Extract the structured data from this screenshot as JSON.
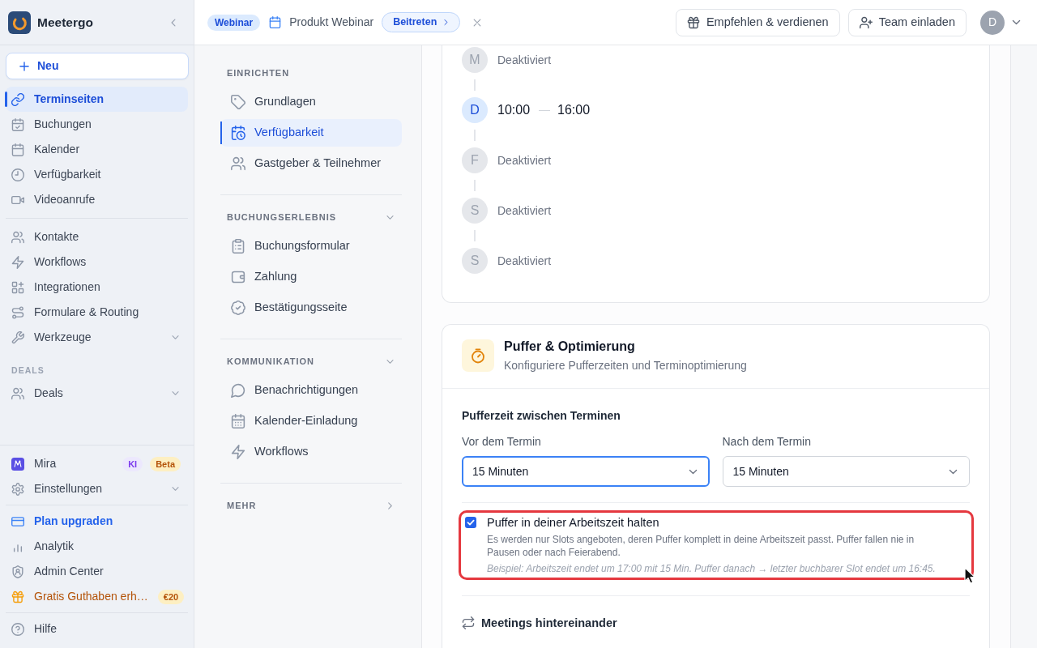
{
  "sidebar": {
    "brand": "Meetergo",
    "new_button": "Neu",
    "groups": [
      {
        "items": [
          {
            "label": "Terminseiten",
            "kind": "link",
            "selected": true
          },
          {
            "label": "Buchungen",
            "kind": "link",
            "selected": false
          },
          {
            "label": "Kalender",
            "kind": "link",
            "selected": false
          },
          {
            "label": "Verfügbarkeit",
            "kind": "link",
            "selected": false
          },
          {
            "label": "Videoanrufe",
            "kind": "link",
            "selected": false
          }
        ]
      },
      {
        "items": [
          {
            "label": "Kontakte",
            "kind": "link",
            "selected": false
          },
          {
            "label": "Workflows",
            "kind": "link",
            "selected": false
          },
          {
            "label": "Integrationen",
            "kind": "link",
            "selected": false
          },
          {
            "label": "Formulare & Routing",
            "kind": "link",
            "selected": false
          },
          {
            "label": "Werkzeuge",
            "kind": "menu",
            "selected": false
          }
        ]
      },
      {
        "title": "DEALS",
        "items": [
          {
            "label": "Deals",
            "kind": "menu",
            "selected": false
          }
        ]
      }
    ],
    "footer_groups": [
      {
        "items": [
          {
            "label": "Mira",
            "kind": "link",
            "selected": false,
            "badges": [
              {
                "text": "KI",
                "kind": "ai"
              },
              {
                "text": "Beta",
                "kind": "beta"
              }
            ]
          },
          {
            "label": "Einstellungen",
            "kind": "menu",
            "selected": false
          }
        ]
      },
      {
        "items": [
          {
            "label": "Plan upgraden",
            "kind": "upgrade",
            "selected": false
          },
          {
            "label": "Analytik",
            "kind": "link",
            "selected": false
          },
          {
            "label": "Admin Center",
            "kind": "link",
            "selected": false
          },
          {
            "label": "Gratis Guthaben erh…",
            "kind": "reward",
            "selected": false,
            "badges": [
              {
                "text": "€20",
                "kind": "amount"
              }
            ]
          }
        ]
      },
      {
        "items": [
          {
            "label": "Hilfe",
            "kind": "link",
            "selected": false
          }
        ]
      }
    ]
  },
  "topbar": {
    "event_type": "Webinar",
    "event_title": "Produkt Webinar",
    "join_button": "Beitreten",
    "actions": [
      "Empfehlen & verdienen",
      "Team einladen"
    ],
    "avatar": "D"
  },
  "settings_nav": {
    "sections": [
      {
        "title": "EINRICHTEN",
        "kind": "static",
        "expanded": true,
        "items": [
          {
            "label": "Grundlagen",
            "selected": false
          },
          {
            "label": "Verfügbarkeit",
            "selected": true
          },
          {
            "label": "Gastgeber & Teilnehmer",
            "selected": false
          }
        ]
      },
      {
        "title": "BUCHUNGSERLEBNIS",
        "kind": "collapsible",
        "expanded": true,
        "items": [
          {
            "label": "Buchungsformular",
            "selected": false
          },
          {
            "label": "Zahlung",
            "selected": false
          },
          {
            "label": "Bestätigungsseite",
            "selected": false
          }
        ]
      },
      {
        "title": "KOMMUNIKATION",
        "kind": "collapsible",
        "expanded": true,
        "items": [
          {
            "label": "Benachrichtigungen",
            "selected": false
          },
          {
            "label": "Kalender-Einladung",
            "selected": false
          },
          {
            "label": "Workflows",
            "selected": false
          }
        ]
      },
      {
        "title": "MEHR",
        "kind": "collapsible",
        "expanded": false
      }
    ]
  },
  "availability": {
    "days": [
      {
        "letter": "M",
        "enabled": false,
        "status": "Deaktiviert"
      },
      {
        "letter": "D",
        "enabled": true,
        "start": "10:00",
        "end": "16:00"
      },
      {
        "letter": "F",
        "enabled": false,
        "status": "Deaktiviert"
      },
      {
        "letter": "S",
        "enabled": false,
        "status": "Deaktiviert"
      },
      {
        "letter": "S",
        "enabled": false,
        "status": "Deaktiviert"
      }
    ]
  },
  "buffer_card": {
    "title": "Puffer & Optimierung",
    "subtitle": "Konfiguriere Pufferzeiten und Terminoptimierung",
    "buffer_heading": "Pufferzeit zwischen Terminen",
    "fields": [
      {
        "label": "Vor dem Termin",
        "value": "15 Minuten",
        "focused": true
      },
      {
        "label": "Nach dem Termin",
        "value": "15 Minuten",
        "focused": false
      }
    ],
    "keep_in_hours": {
      "label": "Puffer in deiner Arbeitszeit halten",
      "checked": true,
      "highlighted": true,
      "description": "Es werden nur Slots angeboten, deren Puffer komplett in deine Arbeitszeit passt. Puffer fallen nie in Pausen oder nach Feierabend.",
      "example": "Beispiel: Arbeitszeit endet um 17:00 mit 15 Min. Puffer danach → letzter buchbarer Slot endet um 16:45."
    },
    "back_to_back_heading": "Meetings hintereinander"
  }
}
